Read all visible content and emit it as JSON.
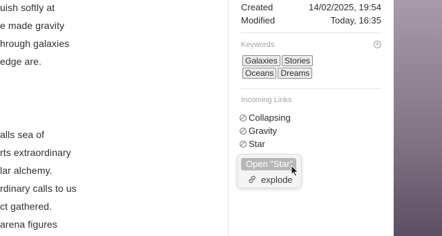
{
  "editor": {
    "lines": [
      "uish softly at",
      "e made gravity",
      "hrough galaxies",
      "edge are.",
      "alls sea of",
      "rts extraordinary",
      "lar alchemy.",
      "rdinary calls to us",
      "ct gathered.",
      "arena figures"
    ]
  },
  "inspector": {
    "created_label": "Created",
    "created_value": "14/02/2025, 19:54",
    "modified_label": "Modified",
    "modified_value": "Today, 16:35",
    "keywords_title": "Keywords",
    "add_icon": "plus-circle-icon",
    "keywords_row1": [
      "Galaxies",
      "Stories"
    ],
    "keywords_row2": [
      "Oceans",
      "Dreams"
    ],
    "incoming_title": "Incoming Links",
    "incoming_links": [
      "Collapsing",
      "Gravity",
      "Star"
    ]
  },
  "popover": {
    "open_label": "Open “Star”",
    "item_label": "explode",
    "item_icon": "link-chain-icon"
  },
  "colors": {
    "desktop_top": "#a79aaa",
    "desktop_bottom": "#5c4f62",
    "highlight": "#b7b7b7"
  }
}
